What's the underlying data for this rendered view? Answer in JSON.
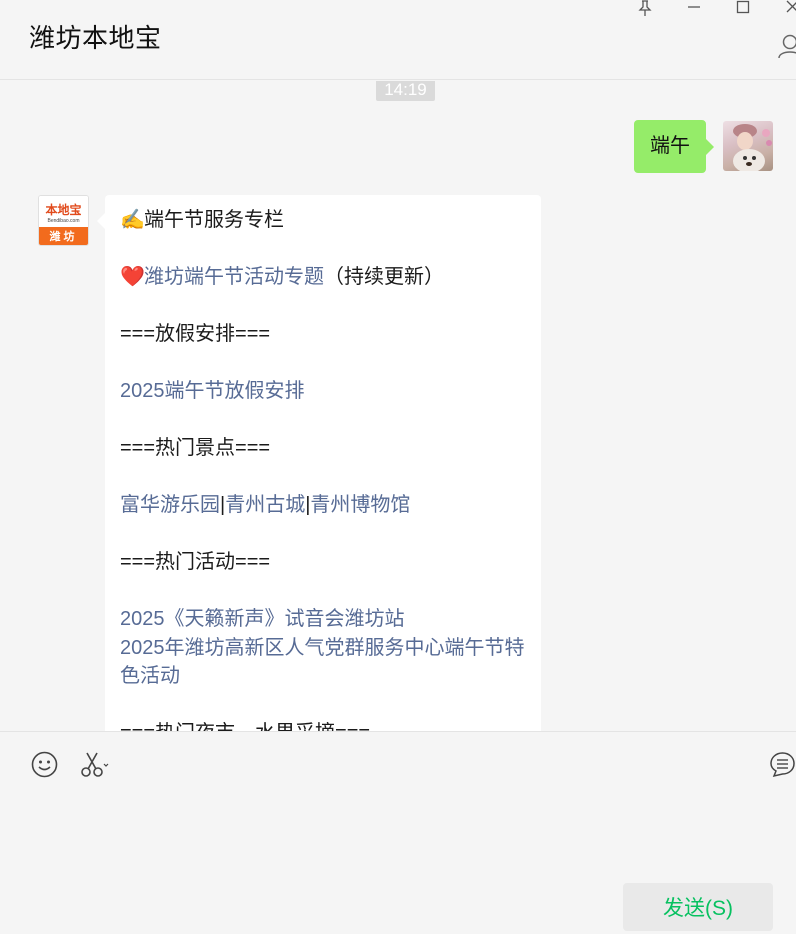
{
  "header": {
    "title": "潍坊本地宝"
  },
  "chat": {
    "timestamp": "14:19",
    "my_message": "端午",
    "avatar_brand": "本地宝",
    "avatar_url": "Bendibao.com",
    "avatar_city": "潍坊",
    "message": {
      "line1_emoji": "✍️",
      "line1_text": "端午节服务专栏",
      "line2_emoji": "❤️",
      "line2_link": "潍坊端午节活动专题",
      "line2_suffix": "（持续更新）",
      "section1": "===放假安排===",
      "holiday_link": "2025端午节放假安排",
      "section2": "===热门景点===",
      "spot1": "富华游乐园",
      "sep1": "|",
      "spot2": "青州古城",
      "sep2": "|",
      "spot3": "青州博物馆",
      "section3": "===热门活动===",
      "activity1": "2025《天籁新声》试音会潍坊站",
      "activity2": "2025年潍坊高新区人气党群服务中心端午节特色活动",
      "section4": "===热门夜市、水果采摘==="
    }
  },
  "input": {
    "send_label": "发送(S)"
  },
  "icons": {
    "pin": "pin-icon",
    "minimize": "minimize-icon",
    "maximize": "maximize-icon",
    "close": "close-icon",
    "person": "person-icon",
    "emoji": "emoji-icon",
    "scissors": "scissors-icon",
    "chat_history": "chat-history-icon"
  },
  "colors": {
    "bubble_me": "#95ec69",
    "link": "#576b95",
    "send_text": "#07c160",
    "brand_orange": "#f26b1d"
  }
}
